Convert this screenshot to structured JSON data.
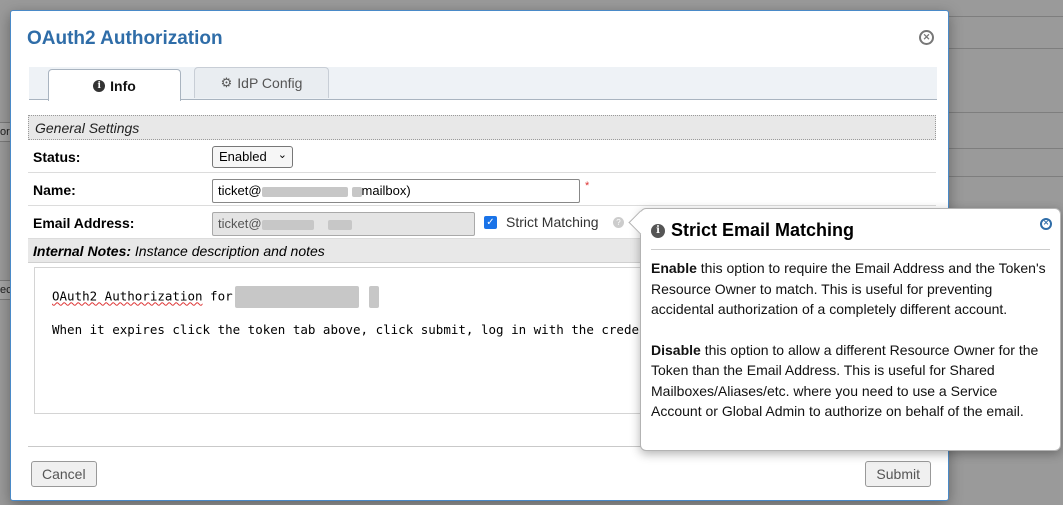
{
  "dialog": {
    "title": "OAuth2 Authorization",
    "tabs": [
      {
        "label": "Info",
        "icon": "info-icon",
        "active": true
      },
      {
        "label": "IdP Config",
        "icon": "gear-icon",
        "active": false
      }
    ]
  },
  "form": {
    "general_settings": "General Settings",
    "status_label": "Status:",
    "status_value": "Enabled",
    "name_label": "Name:",
    "name_prefix": "ticket@",
    "name_suffix": "mailbox)",
    "name_required": "*",
    "email_label": "Email Address:",
    "email_prefix": "ticket@",
    "strict_matching_label": "Strict Matching",
    "strict_matching_checked": true,
    "notes_label": "Internal Notes:",
    "notes_desc": "Instance description and notes",
    "notes_line1_prefix": "OAuth2 Authorization",
    "notes_line1_for": "for",
    "notes_line2": "When it expires click the token tab above, click submit, log in with the credentials for this"
  },
  "buttons": {
    "cancel": "Cancel",
    "submit": "Submit"
  },
  "popover": {
    "title": "Strict Email Matching",
    "enable_word": "Enable",
    "enable_text": " this option to require the Email Address and the Token's Resource Owner to match. This is useful for preventing accidental authorization of a completely different account.",
    "disable_word": "Disable",
    "disable_text": " this option to allow a different Resource Owner for the Token than the Email Address. This is useful for Shared Mailboxes/Aliases/etc. where you need to use a Service Account or Global Admin to authorize on behalf of the email."
  },
  "background": {
    "frag1": "or",
    "frag2": "ec"
  },
  "colors": {
    "title": "#2f6da8",
    "accent": "#1a73e8",
    "overlay": "#9a9a9a"
  }
}
